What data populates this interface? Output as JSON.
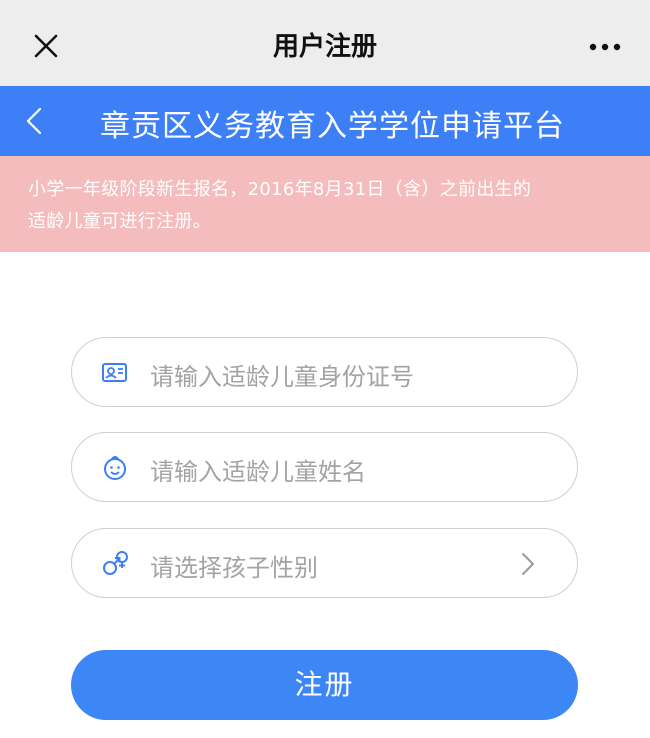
{
  "topbar": {
    "title": "用户注册"
  },
  "header": {
    "title": "章贡区义务教育入学学位申请平台"
  },
  "notice": {
    "line1": "小学一年级阶段新生报名，2016年8月31日（含）之前出生的",
    "line2": "适龄儿童可进行注册。"
  },
  "form": {
    "id_placeholder": "请输入适龄儿童身份证号",
    "name_placeholder": "请输入适龄儿童姓名",
    "gender_placeholder": "请选择孩子性别",
    "submit_label": "注册"
  },
  "colors": {
    "primary": "#3d7ff7",
    "notice_bg": "#f4bcbd",
    "topbar_bg": "#ededed"
  }
}
